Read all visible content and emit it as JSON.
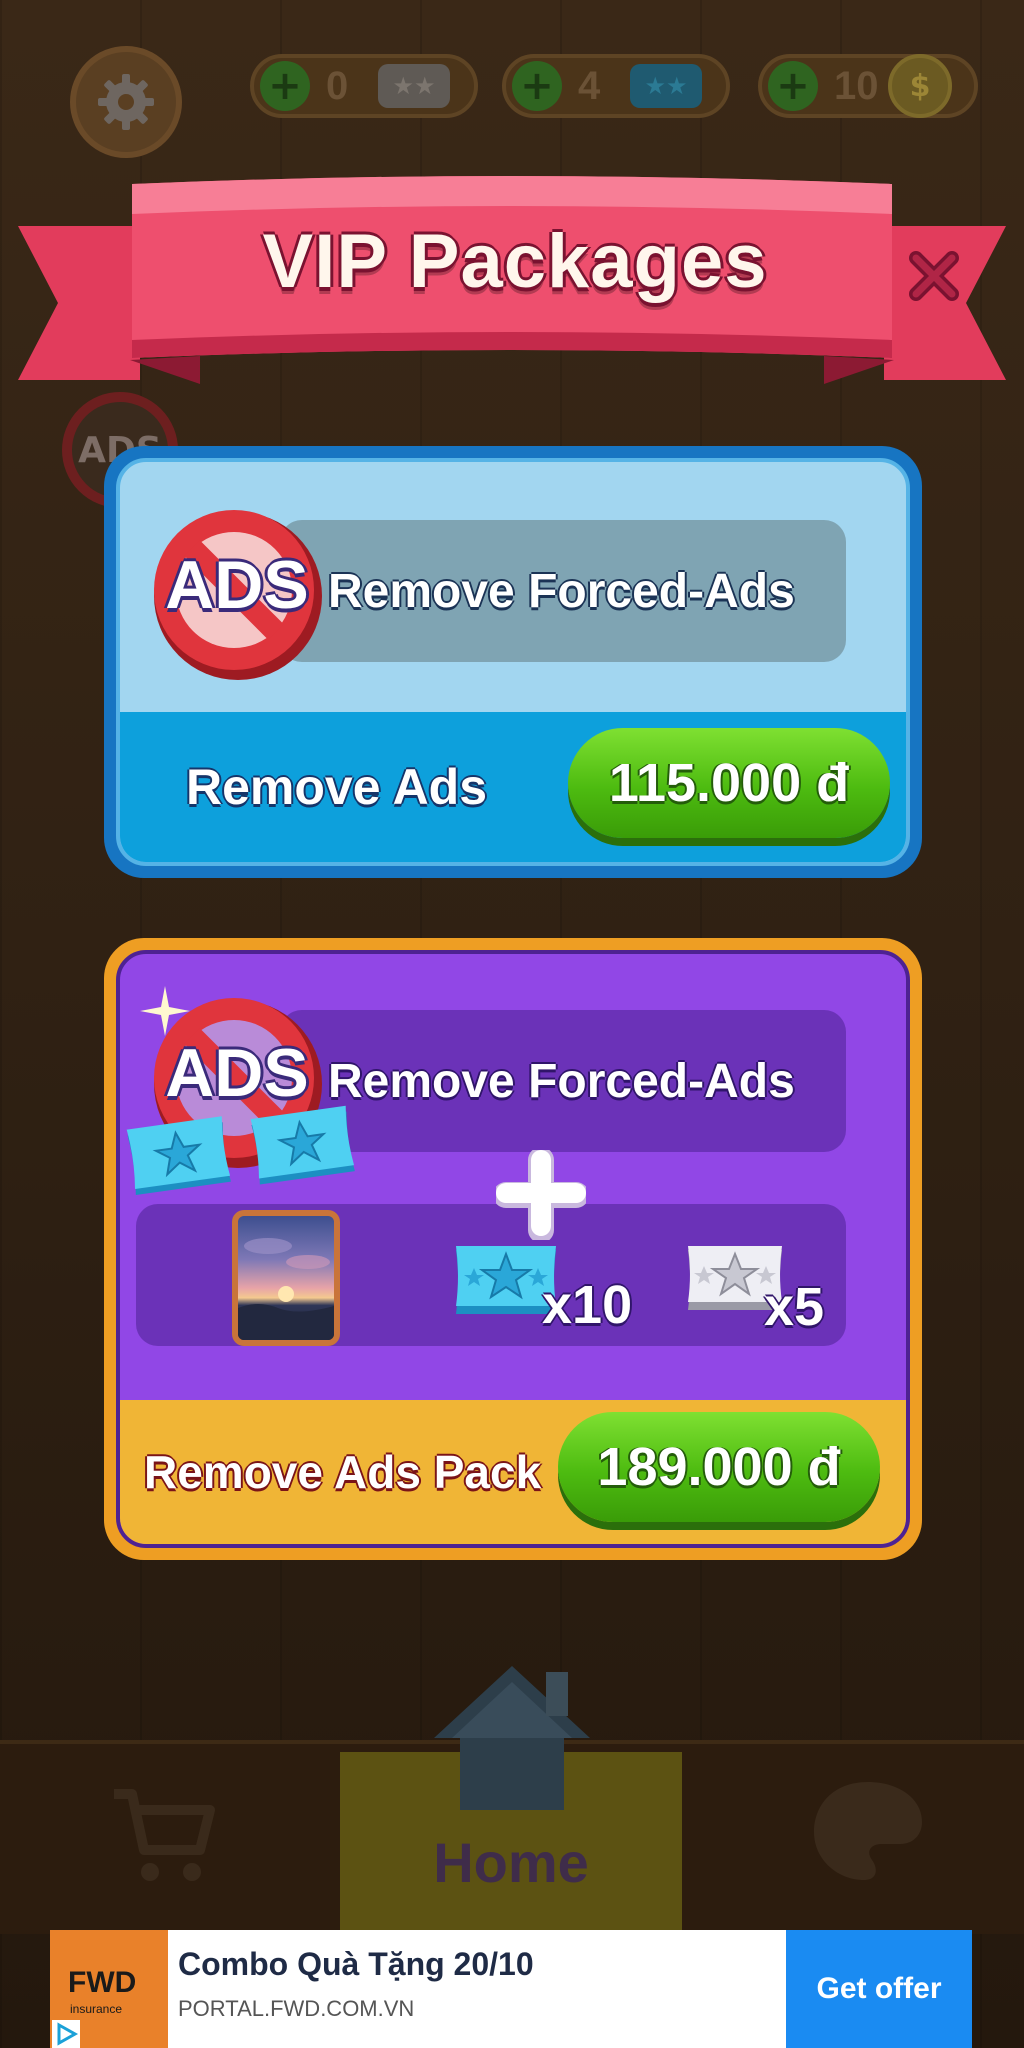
{
  "hud": {
    "gold_tickets": "0",
    "blue_tickets": "4",
    "coins": "10"
  },
  "background": {
    "ads_badge": "ADS",
    "home_tab": "Home"
  },
  "dialog": {
    "title": "VIP Packages"
  },
  "packages": [
    {
      "icon_text": "ADS",
      "feature": "Remove Forced-Ads",
      "name": "Remove Ads",
      "price": "115.000 đ",
      "colors": {
        "frame": "#1775c2",
        "panel": "#a2d6f0",
        "footer": "#0da0dc"
      }
    },
    {
      "icon_text": "ADS",
      "feature": "Remove Forced-Ads",
      "plus": "+",
      "rewards": [
        {
          "icon": "blue-star-ticket-icon",
          "count": "x10"
        },
        {
          "icon": "silver-star-ticket-icon",
          "count": "x5"
        }
      ],
      "name": "Remove Ads Pack",
      "price": "189.000 đ",
      "colors": {
        "frame": "#ee9e23",
        "panel": "#9147e6",
        "footer": "#f0b536"
      }
    }
  ],
  "ad": {
    "logo": "FWD",
    "logo_sub": "insurance",
    "title": "Combo Quà Tặng 20/10",
    "url": "PORTAL.FWD.COM.VN",
    "cta": "Get offer"
  },
  "accent_colors": {
    "banner": "#e83e62",
    "price_button": "#4dbb10",
    "close": "#7a1230"
  }
}
